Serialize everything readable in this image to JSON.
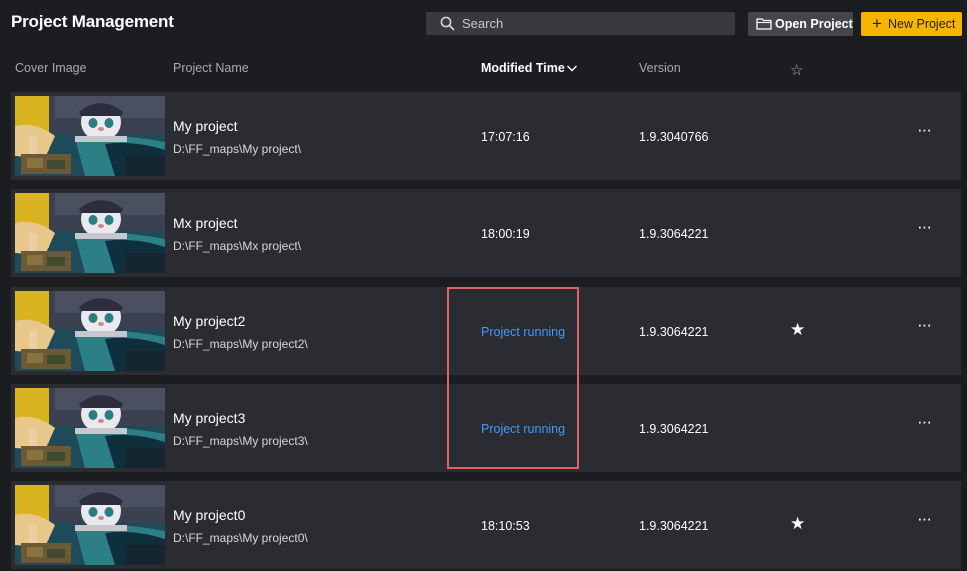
{
  "app": {
    "title": "Project Management"
  },
  "search": {
    "placeholder": "Search"
  },
  "toolbar": {
    "open_label": "Open Project",
    "new_label": "New Project",
    "new_icon": "+"
  },
  "columns": {
    "cover": "Cover Image",
    "name": "Project Name",
    "modified": "Modified Time",
    "version": "Version",
    "favorite_icon": "☆"
  },
  "more_icon": "···",
  "star_icon": "★",
  "projects": [
    {
      "name": "My project",
      "path": "D:\\FF_maps\\My project\\",
      "modified": "17:07:16",
      "running": false,
      "version": "1.9.3040766",
      "favorite": false
    },
    {
      "name": "Mx project",
      "path": "D:\\FF_maps\\Mx project\\",
      "modified": "18:00:19",
      "running": false,
      "version": "1.9.3064221",
      "favorite": false
    },
    {
      "name": "My project2",
      "path": "D:\\FF_maps\\My project2\\",
      "modified": "Project running",
      "running": true,
      "version": "1.9.3064221",
      "favorite": true
    },
    {
      "name": "My project3",
      "path": "D:\\FF_maps\\My project3\\",
      "modified": "Project running",
      "running": true,
      "version": "1.9.3064221",
      "favorite": false
    },
    {
      "name": "My project0",
      "path": "D:\\FF_maps\\My project0\\",
      "modified": "18:10:53",
      "running": false,
      "version": "1.9.3064221",
      "favorite": true
    }
  ],
  "colors": {
    "accent": "#f7b500",
    "running": "#3f9bff",
    "highlight": "#e06262",
    "row_bg": "#2b2c31",
    "page_bg": "#1c1d21"
  }
}
